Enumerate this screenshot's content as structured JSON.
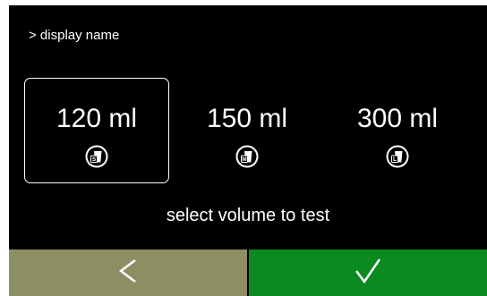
{
  "header": {
    "breadcrumb": "> display name"
  },
  "options": [
    {
      "label": "120 ml",
      "size_code": "S",
      "icon": "cup-small-icon",
      "selected": true
    },
    {
      "label": "150 ml",
      "size_code": "M",
      "icon": "cup-medium-icon",
      "selected": false
    },
    {
      "label": "300 ml",
      "size_code": "L",
      "icon": "cup-large-icon",
      "selected": false
    }
  ],
  "instruction": "select volume to test",
  "footer": {
    "back_icon": "chevron-left-icon",
    "confirm_icon": "checkmark-icon"
  },
  "colors": {
    "screen_bg": "#000000",
    "back_button": "#8e8e64",
    "confirm_button": "#0b8a1f",
    "text": "#ffffff"
  }
}
